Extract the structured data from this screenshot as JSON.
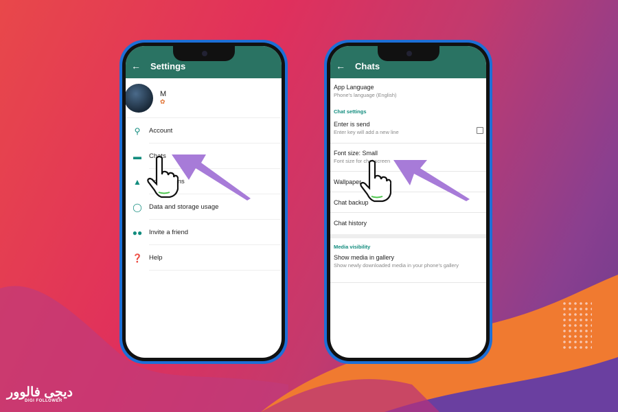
{
  "settings_screen": {
    "title": "Settings",
    "profile": {
      "name": "M",
      "status_icon": "butterfly"
    },
    "items": [
      {
        "label": "Account",
        "icon": "key-icon"
      },
      {
        "label": "Chats",
        "icon": "chat-icon"
      },
      {
        "label": "Notifications",
        "icon": "bell-icon"
      },
      {
        "label": "Data and storage usage",
        "icon": "data-usage-icon"
      },
      {
        "label": "Invite a friend",
        "icon": "people-icon"
      },
      {
        "label": "Help",
        "icon": "help-icon"
      }
    ]
  },
  "chats_screen": {
    "title": "Chats",
    "app_language": {
      "title": "App Language",
      "subtitle": "Phone's language (English)"
    },
    "chat_settings_header": "Chat settings",
    "enter_is_send": {
      "title": "Enter is send",
      "subtitle": "Enter key will add a new line",
      "checked": false
    },
    "font_size": {
      "title": "Font size: Small",
      "subtitle": "Font size for chat screen"
    },
    "wallpaper": "Wallpaper",
    "chat_backup": "Chat backup",
    "chat_history": "Chat history",
    "media_visibility_header": "Media visibility",
    "show_media": {
      "title": "Show media in gallery",
      "subtitle": "Show newly downloaded media in your phone's gallery",
      "checked": true
    }
  },
  "brand": {
    "logo_fa": "دیجی فالوور",
    "logo_en": "DIGI FOLLOWER"
  },
  "colors": {
    "header": "#2a7363",
    "accent": "#128c7e",
    "arrow": "#a77bd8",
    "phone_frame": "#1d6fd6"
  }
}
